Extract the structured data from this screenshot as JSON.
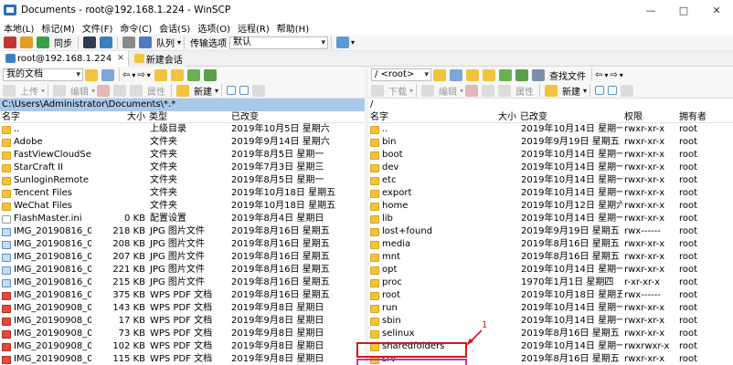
{
  "window": {
    "title": "Documents - root@192.168.1.224 - WinSCP",
    "minimize": "—",
    "maximize": "□",
    "close": "✕"
  },
  "menu": [
    "本地(L)",
    "标记(M)",
    "文件(F)",
    "命令(C)",
    "会话(S)",
    "选项(O)",
    "远程(R)",
    "帮助(H)"
  ],
  "toolbar": {
    "sync_label": "同步",
    "queue_label": "队列",
    "transfer_label": "传输选项",
    "transfer_value": "默认"
  },
  "session": {
    "tab_label": "root@192.168.1.224",
    "new_session_label": "新建会话"
  },
  "left_pane": {
    "location": "我的文档",
    "upload_label": "上传",
    "edit_label": "编辑",
    "props_label": "属性",
    "new_label": "新建",
    "path": "C:\\Users\\Administrator\\Documents\\*.*",
    "columns": {
      "name": "名字",
      "size": "大小",
      "type": "类型",
      "changed": "已改变"
    },
    "rows": [
      {
        "icon": "up",
        "name": "..",
        "size": "",
        "type": "上级目录",
        "changed": "2019年10月5日 星期六"
      },
      {
        "icon": "folder",
        "name": "Adobe",
        "size": "",
        "type": "文件夹",
        "changed": "2019年9月14日 星期六"
      },
      {
        "icon": "folder",
        "name": "FastViewCloudService",
        "size": "",
        "type": "文件夹",
        "changed": "2019年8月5日 星期一"
      },
      {
        "icon": "folder",
        "name": "StarCraft II",
        "size": "",
        "type": "文件夹",
        "changed": "2019年7月3日 星期三"
      },
      {
        "icon": "folder",
        "name": "SunloginRemote",
        "size": "",
        "type": "文件夹",
        "changed": "2019年8月5日 星期一"
      },
      {
        "icon": "folder",
        "name": "Tencent Files",
        "size": "",
        "type": "文件夹",
        "changed": "2019年10月18日 星期五"
      },
      {
        "icon": "folder",
        "name": "WeChat Files",
        "size": "",
        "type": "文件夹",
        "changed": "2019年10月18日 星期五"
      },
      {
        "icon": "ini",
        "name": "FlashMaster.ini",
        "size": "0 KB",
        "type": "配置设置",
        "changed": "2019年8月4日 星期日"
      },
      {
        "icon": "jpg",
        "name": "IMG_20190816_000...",
        "size": "218 KB",
        "type": "JPG 图片文件",
        "changed": "2019年8月16日 星期五"
      },
      {
        "icon": "jpg",
        "name": "IMG_20190816_000...",
        "size": "208 KB",
        "type": "JPG 图片文件",
        "changed": "2019年8月16日 星期五"
      },
      {
        "icon": "jpg",
        "name": "IMG_20190816_000...",
        "size": "207 KB",
        "type": "JPG 图片文件",
        "changed": "2019年8月16日 星期五"
      },
      {
        "icon": "jpg",
        "name": "IMG_20190816_000...",
        "size": "221 KB",
        "type": "JPG 图片文件",
        "changed": "2019年8月16日 星期五"
      },
      {
        "icon": "jpg",
        "name": "IMG_20190816_000...",
        "size": "215 KB",
        "type": "JPG 图片文件",
        "changed": "2019年8月16日 星期五"
      },
      {
        "icon": "pdf",
        "name": "IMG_20190816_000...",
        "size": "375 KB",
        "type": "WPS PDF 文档",
        "changed": "2019年8月16日 星期五"
      },
      {
        "icon": "pdf",
        "name": "IMG_20190908_000...",
        "size": "143 KB",
        "type": "WPS PDF 文档",
        "changed": "2019年9月8日 星期日"
      },
      {
        "icon": "pdf",
        "name": "IMG_20190908_000...",
        "size": "17 KB",
        "type": "WPS PDF 文档",
        "changed": "2019年9月8日 星期日"
      },
      {
        "icon": "pdf",
        "name": "IMG_20190908_000...",
        "size": "73 KB",
        "type": "WPS PDF 文档",
        "changed": "2019年9月8日 星期日"
      },
      {
        "icon": "pdf",
        "name": "IMG_20190908_000...",
        "size": "102 KB",
        "type": "WPS PDF 文档",
        "changed": "2019年9月8日 星期日"
      },
      {
        "icon": "pdf",
        "name": "IMG_20190908_000...",
        "size": "115 KB",
        "type": "WPS PDF 文档",
        "changed": "2019年9月8日 星期日"
      }
    ]
  },
  "right_pane": {
    "location": "/ <root>",
    "find_label": "查找文件",
    "download_label": "下载",
    "edit_label": "编辑",
    "props_label": "属性",
    "new_label": "新建",
    "path": "/",
    "columns": {
      "name": "名字",
      "size": "大小",
      "changed": "已改变",
      "rights": "权限",
      "owner": "拥有者"
    },
    "rows": [
      {
        "icon": "up",
        "name": "..",
        "size": "",
        "changed": "2019年10月14日 星期一",
        "rights": "rwxr-xr-x",
        "owner": "root"
      },
      {
        "icon": "folder",
        "name": "bin",
        "size": "",
        "changed": "2019年9月19日 星期五",
        "rights": "rwxr-xr-x",
        "owner": "root"
      },
      {
        "icon": "folder",
        "name": "boot",
        "size": "",
        "changed": "2019年10月14日 星期一",
        "rights": "rwxr-xr-x",
        "owner": "root"
      },
      {
        "icon": "folder",
        "name": "dev",
        "size": "",
        "changed": "2019年10月14日 星期一",
        "rights": "rwxr-xr-x",
        "owner": "root"
      },
      {
        "icon": "folder",
        "name": "etc",
        "size": "",
        "changed": "2019年10月14日 星期一",
        "rights": "rwxr-xr-x",
        "owner": "root"
      },
      {
        "icon": "folder",
        "name": "export",
        "size": "",
        "changed": "2019年10月14日 星期一",
        "rights": "rwxr-xr-x",
        "owner": "root"
      },
      {
        "icon": "folder",
        "name": "home",
        "size": "",
        "changed": "2019年10月12日 星期六",
        "rights": "rwxr-xr-x",
        "owner": "root"
      },
      {
        "icon": "folder",
        "name": "lib",
        "size": "",
        "changed": "2019年10月14日 星期一",
        "rights": "rwxr-xr-x",
        "owner": "root"
      },
      {
        "icon": "folder",
        "name": "lost+found",
        "size": "",
        "changed": "2019年9月19日 星期五",
        "rights": "rwx------",
        "owner": "root"
      },
      {
        "icon": "folder",
        "name": "media",
        "size": "",
        "changed": "2019年8月16日 星期五",
        "rights": "rwxr-xr-x",
        "owner": "root"
      },
      {
        "icon": "folder",
        "name": "mnt",
        "size": "",
        "changed": "2019年8月16日 星期五",
        "rights": "rwxr-xr-x",
        "owner": "root"
      },
      {
        "icon": "folder",
        "name": "opt",
        "size": "",
        "changed": "2019年10月14日 星期一",
        "rights": "rwxr-xr-x",
        "owner": "root"
      },
      {
        "icon": "folder",
        "name": "proc",
        "size": "",
        "changed": "1970年1月1日 星期四",
        "rights": "r-xr-xr-x",
        "owner": "root"
      },
      {
        "icon": "folder",
        "name": "root",
        "size": "",
        "changed": "2019年10月18日 星期五",
        "rights": "rwx------",
        "owner": "root"
      },
      {
        "icon": "folder",
        "name": "run",
        "size": "",
        "changed": "2019年10月14日 星期一",
        "rights": "rwxr-xr-x",
        "owner": "root"
      },
      {
        "icon": "folder",
        "name": "sbin",
        "size": "",
        "changed": "2019年10月14日 星期一",
        "rights": "rwxr-xr-x",
        "owner": "root"
      },
      {
        "icon": "folder",
        "name": "selinux",
        "size": "",
        "changed": "2019年8月16日 星期五",
        "rights": "rwxr-xr-x",
        "owner": "root"
      },
      {
        "icon": "folder",
        "name": "sharedfolders",
        "size": "",
        "changed": "2019年10月14日 星期一",
        "rights": "rwxrwxr-x",
        "owner": "root"
      },
      {
        "icon": "folder",
        "name": "srv",
        "size": "",
        "changed": "2019年8月16日 星期五",
        "rights": "rwxr-xr-x",
        "owner": "root"
      }
    ]
  },
  "annotation": {
    "number": "1"
  },
  "colors": {
    "active_path_bg": "#a8c9ea",
    "folder": "#f3c33d",
    "highlight_red": "#d8141c",
    "highlight_purple": "#c13aa3"
  }
}
